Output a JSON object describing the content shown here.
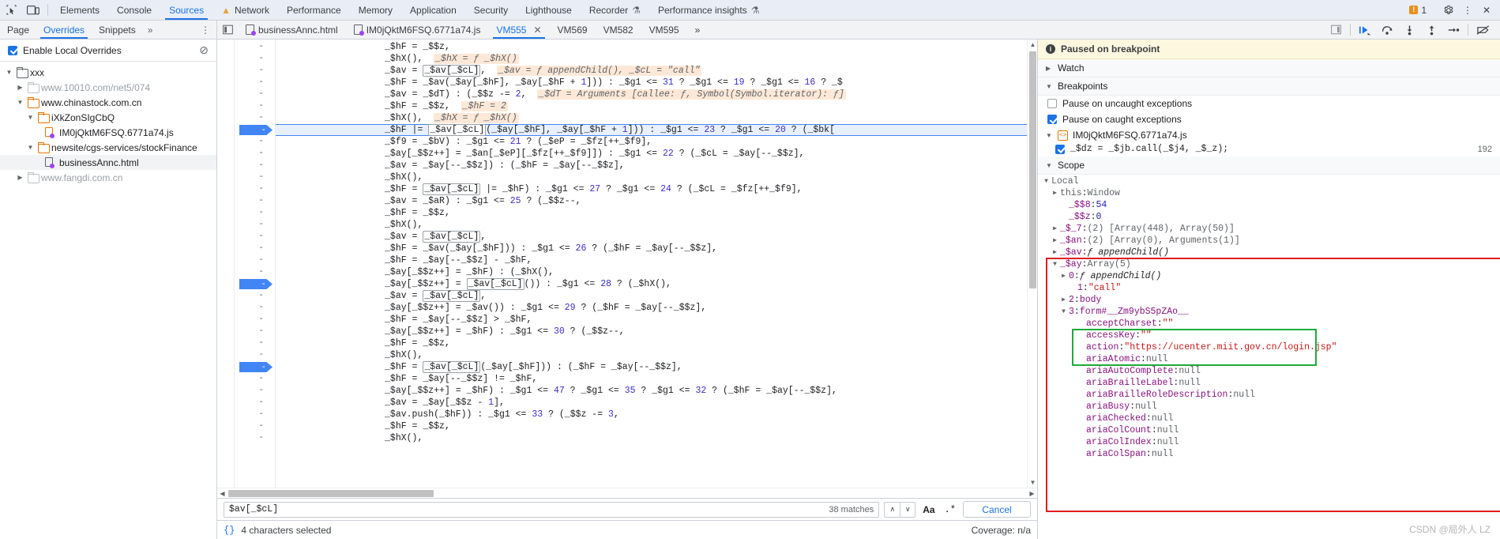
{
  "topbar": {
    "icons": [
      "inspect-element-icon",
      "device-toolbar-icon"
    ],
    "tabs": [
      {
        "label": "Elements",
        "selected": false,
        "icon": ""
      },
      {
        "label": "Console",
        "selected": false,
        "icon": ""
      },
      {
        "label": "Sources",
        "selected": true,
        "icon": ""
      },
      {
        "label": "Network",
        "selected": false,
        "icon": "warning-triangle"
      },
      {
        "label": "Performance",
        "selected": false,
        "icon": ""
      },
      {
        "label": "Memory",
        "selected": false,
        "icon": ""
      },
      {
        "label": "Application",
        "selected": false,
        "icon": ""
      },
      {
        "label": "Security",
        "selected": false,
        "icon": ""
      },
      {
        "label": "Lighthouse",
        "selected": false,
        "icon": ""
      },
      {
        "label": "Recorder",
        "selected": false,
        "icon": "flask"
      },
      {
        "label": "Performance insights",
        "selected": false,
        "icon": "flask"
      }
    ],
    "error_count": "1",
    "settings_label": "Settings",
    "more_label": "More options",
    "close_label": "Close DevTools"
  },
  "subbar": {
    "nav_tabs": [
      {
        "label": "Page",
        "selected": false
      },
      {
        "label": "Overrides",
        "selected": true
      },
      {
        "label": "Snippets",
        "selected": false
      }
    ],
    "more_tabs": "»",
    "more_options": "⋮",
    "file_tabs": [
      {
        "label": "businessAnnc.html",
        "selected": false,
        "has_icon": true,
        "closable": false
      },
      {
        "label": "IM0jQktM6FSQ.6771a74.js",
        "selected": false,
        "has_icon": true,
        "closable": false
      },
      {
        "label": "VM555",
        "selected": true,
        "has_icon": false,
        "closable": true
      },
      {
        "label": "VM569",
        "selected": false,
        "has_icon": false,
        "closable": false
      },
      {
        "label": "VM582",
        "selected": false,
        "has_icon": false,
        "closable": false
      },
      {
        "label": "VM595",
        "selected": false,
        "has_icon": false,
        "closable": false
      },
      {
        "label": "»",
        "selected": false,
        "has_icon": false,
        "closable": false
      }
    ],
    "debug_buttons": [
      "resume-script-execution",
      "step-over-next-function-call",
      "step-into-next-function-call",
      "step-out-of-current-function",
      "step",
      "deactivate-breakpoints"
    ]
  },
  "navigator": {
    "overrides_checkbox_label": "Enable Local Overrides",
    "overrides_checked": true,
    "clear_icon": "clear-configuration-icon",
    "tree": [
      {
        "depth": 0,
        "label": "xxx",
        "type": "folder",
        "state": "expanded",
        "color": "gray-dark",
        "muted": false,
        "selected": false
      },
      {
        "depth": 1,
        "label": "www.10010.com/net5/074",
        "type": "folder",
        "state": "collapsed",
        "color": "gray",
        "muted": true,
        "selected": false
      },
      {
        "depth": 1,
        "label": "www.chinastock.com.cn",
        "type": "folder",
        "state": "expanded",
        "color": "orange",
        "muted": false,
        "selected": false
      },
      {
        "depth": 2,
        "label": "iXkZonSIgCbQ",
        "type": "folder",
        "state": "expanded",
        "color": "orange",
        "muted": false,
        "selected": false
      },
      {
        "depth": 3,
        "label": "IM0jQktM6FSQ.6771a74.js",
        "type": "file-js",
        "state": "",
        "color": "orange",
        "muted": false,
        "selected": false
      },
      {
        "depth": 2,
        "label": "newsite/cgs-services/stockFinance",
        "type": "folder",
        "state": "expanded",
        "color": "orange",
        "muted": false,
        "selected": false
      },
      {
        "depth": 3,
        "label": "businessAnnc.html",
        "type": "file-html",
        "state": "",
        "color": "gray-dark",
        "muted": false,
        "selected": true
      },
      {
        "depth": 1,
        "label": "www.fangdi.com.cn",
        "type": "folder",
        "state": "collapsed",
        "color": "gray",
        "muted": true,
        "selected": false
      }
    ]
  },
  "editor": {
    "gutter_marker": "-",
    "lines": [
      {
        "text": "_$hF = _$$z,",
        "bp": false,
        "hl": false
      },
      {
        "text": "_$hX(),",
        "hint": "_$hX = ƒ _$hX()",
        "bp": false,
        "hl": false
      },
      {
        "text": "_$av = _$av[_$cL],",
        "hint": "_$av = ƒ appendChild(), _$cL = \"call\"",
        "bp": false,
        "hl": false,
        "box": "_$av[_$cL]"
      },
      {
        "text": "_$hF = _$av(_$ay[_$hF], _$ay[_$hF + 1])) : _$g1 <= 31 ? _$g1 <= 19 ? _$g1 <= 16 ? _$",
        "bp": false,
        "hl": false
      },
      {
        "text": "_$av = _$dT) : (_$$z -= 2,",
        "hint": "_$dT = Arguments [callee: ƒ, Symbol(Symbol.iterator): ƒ]",
        "bp": false,
        "hl": false
      },
      {
        "text": "_$hF = _$$z,",
        "hint": "_$hF = 2",
        "bp": false,
        "hl": false
      },
      {
        "text": "_$hX(),",
        "hint": "_$hX = ƒ _$hX()",
        "bp": false,
        "hl": false
      },
      {
        "text": "_$hF |= _$av[_$cL](_$ay[_$hF], _$ay[_$hF + 1])) : _$g1 <= 23 ? _$g1 <= 20 ? (_$bk[",
        "bp": true,
        "hl": true,
        "box": "_$av[_$cL]"
      },
      {
        "text": "_$f9 = _$bV) : _$g1 <= 21 ? (_$eP = _$fz[++_$f9],",
        "bp": false,
        "hl": false
      },
      {
        "text": "_$ay[_$$z++] = _$an[_$eP][_$fz[++_$f9]]) : _$g1 <= 22 ? (_$cL = _$ay[--_$$z],",
        "bp": false,
        "hl": false
      },
      {
        "text": "_$av = _$ay[--_$$z]) : (_$hF = _$ay[--_$$z],",
        "bp": false,
        "hl": false
      },
      {
        "text": "_$hX(),",
        "bp": false,
        "hl": false
      },
      {
        "text": "_$hF = _$av[_$cL] |= _$hF) : _$g1 <= 27 ? _$g1 <= 24 ? (_$cL = _$fz[++_$f9],",
        "bp": false,
        "hl": false,
        "box": "_$av[_$cL]"
      },
      {
        "text": "_$av = _$aR) : _$g1 <= 25 ? (_$$z--,",
        "bp": false,
        "hl": false
      },
      {
        "text": "_$hF = _$$z,",
        "bp": false,
        "hl": false
      },
      {
        "text": "_$hX(),",
        "bp": false,
        "hl": false
      },
      {
        "text": "_$av = _$av[_$cL],",
        "bp": false,
        "hl": false,
        "box": "_$av[_$cL]"
      },
      {
        "text": "_$hF = _$av(_$ay[_$hF])) : _$g1 <= 26 ? (_$hF = _$ay[--_$$z],",
        "bp": false,
        "hl": false
      },
      {
        "text": "_$hF = _$ay[--_$$z] - _$hF,",
        "bp": false,
        "hl": false
      },
      {
        "text": "_$ay[_$$z++] = _$hF) : (_$hX(),",
        "bp": false,
        "hl": false
      },
      {
        "text": "_$ay[_$$z++] = _$av[_$cL]()) : _$g1 <= 28 ? (_$hX(),",
        "bp": true,
        "hl": false,
        "box": "_$av[_$cL]"
      },
      {
        "text": "_$av = _$av[_$cL],",
        "bp": false,
        "hl": false,
        "box": "_$av[_$cL]"
      },
      {
        "text": "_$ay[_$$z++] = _$av()) : _$g1 <= 29 ? (_$hF = _$ay[--_$$z],",
        "bp": false,
        "hl": false
      },
      {
        "text": "_$hF = _$ay[--_$$z] > _$hF,",
        "bp": false,
        "hl": false
      },
      {
        "text": "_$ay[_$$z++] = _$hF) : _$g1 <= 30 ? (_$$z--,",
        "bp": false,
        "hl": false
      },
      {
        "text": "_$hF = _$$z,",
        "bp": false,
        "hl": false
      },
      {
        "text": "_$hX(),",
        "bp": false,
        "hl": false
      },
      {
        "text": "_$hF = _$av[_$cL](_$ay[_$hF])) : (_$hF = _$ay[--_$$z],",
        "bp": true,
        "hl": false,
        "box": "_$av[_$cL]"
      },
      {
        "text": "_$hF = _$ay[--_$$z] != _$hF,",
        "bp": false,
        "hl": false
      },
      {
        "text": "_$ay[_$$z++] = _$hF) : _$g1 <= 47 ? _$g1 <= 35 ? _$g1 <= 32 ? (_$hF = _$ay[--_$$z],",
        "bp": false,
        "hl": false
      },
      {
        "text": "_$av = _$ay[_$$z - 1],",
        "bp": false,
        "hl": false
      },
      {
        "text": "_$av.push(_$hF)) : _$g1 <= 33 ? (_$$z -= 3,",
        "bp": false,
        "hl": false
      },
      {
        "text": "_$hF = _$$z,",
        "bp": false,
        "hl": false
      },
      {
        "text": "_$hX(),",
        "bp": false,
        "hl": false
      }
    ]
  },
  "findbar": {
    "query": "$av[_$cL]",
    "matches": "38 matches",
    "prev_label": "∧",
    "next_label": "∨",
    "match_case_label": "Aa",
    "regex_label": ".*",
    "cancel_label": "Cancel"
  },
  "statusbar": {
    "pretty_print_icon": "{}",
    "selection_text": "4 characters selected",
    "coverage": "Coverage: n/a"
  },
  "debugger": {
    "paused_title": "Paused on breakpoint",
    "watch_label": "Watch",
    "breakpoints_label": "Breakpoints",
    "pause_uncaught_label": "Pause on uncaught exceptions",
    "pause_uncaught_checked": false,
    "pause_caught_label": "Pause on caught exceptions",
    "pause_caught_checked": true,
    "bp_file": "IM0jQktM6FSQ.6771a74.js",
    "bp_code": "_$dz = _$jb.call(_$j4, _$_z);",
    "bp_line": "192",
    "bp_checked": true,
    "scope_label": "Scope",
    "local_label": "Local",
    "scope_rows": [
      {
        "indent": 1,
        "arrow": "▶",
        "key": "this",
        "sep": ": ",
        "value": "Window",
        "keycls": "k-this",
        "valcls": "k-obj"
      },
      {
        "indent": 2,
        "arrow": "",
        "key": "_$$8",
        "sep": ": ",
        "value": "54",
        "keycls": "k-prop",
        "valcls": "k-val-num"
      },
      {
        "indent": 2,
        "arrow": "",
        "key": "_$$z",
        "sep": ": ",
        "value": "0",
        "keycls": "k-prop",
        "valcls": "k-val-num"
      },
      {
        "indent": 1,
        "arrow": "▶",
        "key": "_$_7",
        "sep": ": ",
        "value": "(2) [Array(448), Array(50)]",
        "keycls": "k-prop",
        "valcls": "k-obj"
      },
      {
        "indent": 1,
        "arrow": "▶",
        "key": "_$an",
        "sep": ": ",
        "value": "(2) [Array(0), Arguments(1)]",
        "keycls": "k-prop",
        "valcls": "k-obj"
      },
      {
        "indent": 1,
        "arrow": "▶",
        "key": "_$av",
        "sep": ": ",
        "value": "ƒ appendChild()",
        "keycls": "k-prop",
        "valcls": "k-fn"
      },
      {
        "indent": 1,
        "arrow": "▼",
        "key": "_$ay",
        "sep": ": ",
        "value": "Array(5)",
        "keycls": "k-prop",
        "valcls": "k-obj"
      },
      {
        "indent": 2,
        "arrow": "▶",
        "key": "0",
        "sep": ": ",
        "value": "ƒ appendChild()",
        "keycls": "k-prop",
        "valcls": "k-fn"
      },
      {
        "indent": 3,
        "arrow": "",
        "key": "1",
        "sep": ": ",
        "value": "\"call\"",
        "keycls": "k-prop",
        "valcls": "k-val-str"
      },
      {
        "indent": 2,
        "arrow": "▶",
        "key": "2",
        "sep": ": ",
        "value": "body",
        "keycls": "k-prop",
        "valcls": "k-body"
      },
      {
        "indent": 2,
        "arrow": "▼",
        "key": "3",
        "sep": ": ",
        "value": "form#__Zm9ybS5pZAo__",
        "keycls": "k-prop",
        "valcls": "k-body"
      },
      {
        "indent": 4,
        "arrow": "",
        "key": "acceptCharset",
        "sep": ": ",
        "value": "\"\"",
        "keycls": "k-prop",
        "valcls": "k-val-str"
      },
      {
        "indent": 4,
        "arrow": "",
        "key": "accessKey",
        "sep": ": ",
        "value": "\"\"",
        "keycls": "k-prop",
        "valcls": "k-val-str"
      },
      {
        "indent": 4,
        "arrow": "",
        "key": "action",
        "sep": ": ",
        "value": "\"https://ucenter.miit.gov.cn/login.jsp\"",
        "keycls": "k-prop",
        "valcls": "k-val-str"
      },
      {
        "indent": 4,
        "arrow": "",
        "key": "ariaAtomic",
        "sep": ": ",
        "value": "null",
        "keycls": "k-prop",
        "valcls": "k-null"
      },
      {
        "indent": 4,
        "arrow": "",
        "key": "ariaAutoComplete",
        "sep": ": ",
        "value": "null",
        "keycls": "k-prop",
        "valcls": "k-null"
      },
      {
        "indent": 4,
        "arrow": "",
        "key": "ariaBrailleLabel",
        "sep": ": ",
        "value": "null",
        "keycls": "k-prop",
        "valcls": "k-null"
      },
      {
        "indent": 4,
        "arrow": "",
        "key": "ariaBrailleRoleDescription",
        "sep": ": ",
        "value": "null",
        "keycls": "k-prop",
        "valcls": "k-null"
      },
      {
        "indent": 4,
        "arrow": "",
        "key": "ariaBusy",
        "sep": ": ",
        "value": "null",
        "keycls": "k-prop",
        "valcls": "k-null"
      },
      {
        "indent": 4,
        "arrow": "",
        "key": "ariaChecked",
        "sep": ": ",
        "value": "null",
        "keycls": "k-prop",
        "valcls": "k-null"
      },
      {
        "indent": 4,
        "arrow": "",
        "key": "ariaColCount",
        "sep": ": ",
        "value": "null",
        "keycls": "k-prop",
        "valcls": "k-null"
      },
      {
        "indent": 4,
        "arrow": "",
        "key": "ariaColIndex",
        "sep": ": ",
        "value": "null",
        "keycls": "k-prop",
        "valcls": "k-null"
      },
      {
        "indent": 4,
        "arrow": "",
        "key": "ariaColSpan",
        "sep": ": ",
        "value": "null",
        "keycls": "k-prop",
        "valcls": "k-null"
      }
    ]
  },
  "form_field_name": "form#__Zm9ybS5pZAo__",
  "watermark": "CSDN @局外人 LZ",
  "colors": {
    "accent": "#1a73e8",
    "paused_bg": "#fef7e0",
    "red_box": "#e11d1d",
    "green_box": "#1faa3c",
    "orange_folder": "#e37400",
    "highlight_line": "#e8f0fe"
  }
}
